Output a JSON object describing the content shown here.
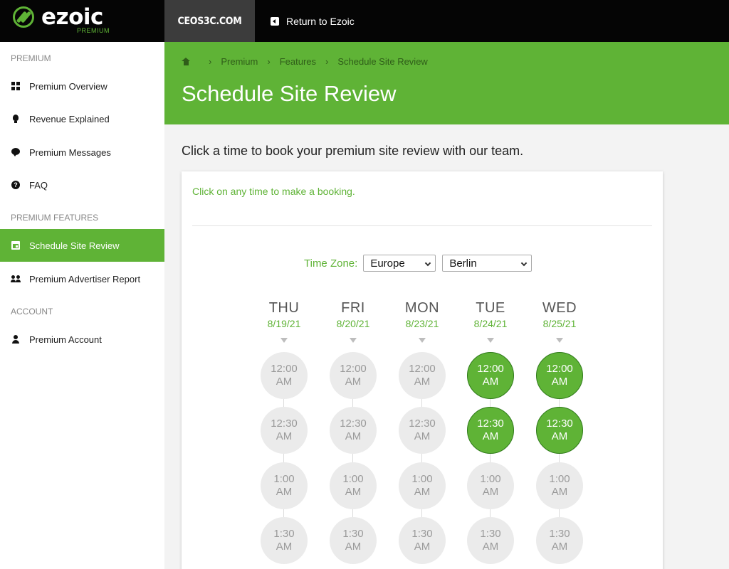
{
  "logo": {
    "word": "ezoic",
    "sub": "PREMIUM"
  },
  "topbar": {
    "site": "CEOS3C.COM",
    "return_label": "Return to Ezoic"
  },
  "sidebar": {
    "sections": [
      {
        "label": "PREMIUM",
        "items": [
          {
            "label": "Premium Overview",
            "icon": "grid-icon"
          },
          {
            "label": "Revenue Explained",
            "icon": "lightbulb-icon"
          },
          {
            "label": "Premium Messages",
            "icon": "chat-icon"
          },
          {
            "label": "FAQ",
            "icon": "help-icon"
          }
        ]
      },
      {
        "label": "PREMIUM FEATURES",
        "items": [
          {
            "label": "Schedule Site Review",
            "icon": "calendar-icon",
            "active": true
          },
          {
            "label": "Premium Advertiser Report",
            "icon": "users-icon"
          }
        ]
      },
      {
        "label": "ACCOUNT",
        "items": [
          {
            "label": "Premium Account",
            "icon": "user-icon"
          }
        ]
      }
    ]
  },
  "breadcrumb": [
    "Premium",
    "Features",
    "Schedule Site Review"
  ],
  "page_title": "Schedule Site Review",
  "intro": "Click a time to book your premium site review with our team.",
  "card": {
    "instruction": "Click on any time to make a booking.",
    "timezone_label": "Time Zone:",
    "region": "Europe",
    "city": "Berlin"
  },
  "days": [
    {
      "name": "THU",
      "date": "8/19/21",
      "slots": [
        {
          "time": "12:00",
          "period": "AM",
          "available": false
        },
        {
          "time": "12:30",
          "period": "AM",
          "available": false
        },
        {
          "time": "1:00",
          "period": "AM",
          "available": false
        },
        {
          "time": "1:30",
          "period": "AM",
          "available": false
        }
      ]
    },
    {
      "name": "FRI",
      "date": "8/20/21",
      "slots": [
        {
          "time": "12:00",
          "period": "AM",
          "available": false
        },
        {
          "time": "12:30",
          "period": "AM",
          "available": false
        },
        {
          "time": "1:00",
          "period": "AM",
          "available": false
        },
        {
          "time": "1:30",
          "period": "AM",
          "available": false
        }
      ]
    },
    {
      "name": "MON",
      "date": "8/23/21",
      "slots": [
        {
          "time": "12:00",
          "period": "AM",
          "available": false
        },
        {
          "time": "12:30",
          "period": "AM",
          "available": false
        },
        {
          "time": "1:00",
          "period": "AM",
          "available": false
        },
        {
          "time": "1:30",
          "period": "AM",
          "available": false
        }
      ]
    },
    {
      "name": "TUE",
      "date": "8/24/21",
      "slots": [
        {
          "time": "12:00",
          "period": "AM",
          "available": true
        },
        {
          "time": "12:30",
          "period": "AM",
          "available": true
        },
        {
          "time": "1:00",
          "period": "AM",
          "available": false
        },
        {
          "time": "1:30",
          "period": "AM",
          "available": false
        }
      ]
    },
    {
      "name": "WED",
      "date": "8/25/21",
      "slots": [
        {
          "time": "12:00",
          "period": "AM",
          "available": true
        },
        {
          "time": "12:30",
          "period": "AM",
          "available": true
        },
        {
          "time": "1:00",
          "period": "AM",
          "available": false
        },
        {
          "time": "1:30",
          "period": "AM",
          "available": false
        }
      ]
    }
  ],
  "colors": {
    "brand_green": "#5fb336",
    "topbar": "#050505",
    "slot_idle": "#ebebeb"
  }
}
